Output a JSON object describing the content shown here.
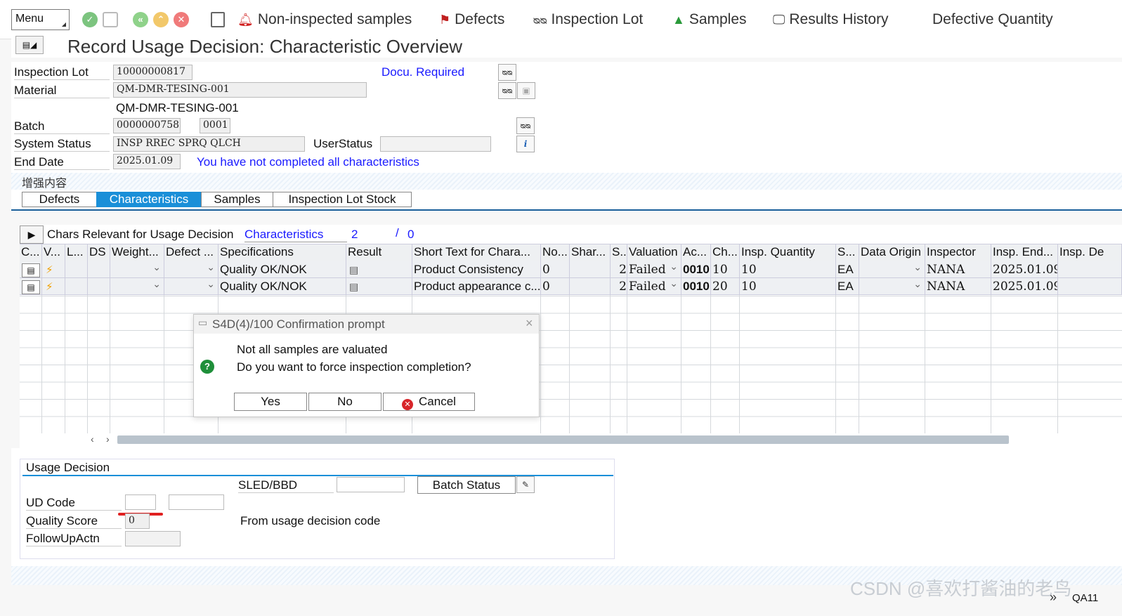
{
  "toolbar": {
    "menu_label": "Menu",
    "items": [
      {
        "label": "Non-inspected samples",
        "icon": "bell-icon"
      },
      {
        "label": "Defects",
        "icon": "flag-icon"
      },
      {
        "label": "Inspection Lot",
        "icon": "glasses-icon"
      },
      {
        "label": "Samples",
        "icon": "shapes-icon"
      },
      {
        "label": "Results History",
        "icon": "monitor-icon"
      },
      {
        "label": "Defective Quantity",
        "icon": ""
      }
    ]
  },
  "title": "Record Usage Decision: Characteristic Overview",
  "header": {
    "inspection_lot_label": "Inspection Lot",
    "inspection_lot": "10000000817",
    "docu_required": "Docu. Required",
    "material_label": "Material",
    "material": "QM-DMR-TESING-001",
    "material_desc": "QM-DMR-TESING-001",
    "batch_label": "Batch",
    "batch": "0000000758",
    "batch_sub": "0001",
    "system_status_label": "System Status",
    "system_status": "INSP RREC SPRQ QLCH",
    "user_status_label": "UserStatus",
    "end_date_label": "End Date",
    "end_date": "2025.01.09",
    "status_message": "You have not completed all characteristics",
    "enhanced_content": "增强内容"
  },
  "tabs": [
    "Defects",
    "Characteristics",
    "Samples",
    "Inspection Lot Stock"
  ],
  "grid": {
    "heading": "Chars Relevant for Usage Decision",
    "characteristics_label": "Characteristics",
    "count_done": "2",
    "slash": "/",
    "count_total": "0",
    "columns": [
      "C...",
      "V...",
      "L...",
      "DS",
      "Weight...",
      "Defect ...",
      "Specifications",
      "Result",
      "Short Text for Chara...",
      "No...",
      "Shar...",
      "S..",
      "Valuation",
      "Ac...",
      "Ch...",
      "Insp. Quantity",
      "S...",
      "Data Origin",
      "Inspector",
      "Insp. End...",
      "Insp. De"
    ],
    "rows": [
      {
        "spec": "Quality OK/NOK",
        "short_text": "Product Consistency",
        "no": "0",
        "s": "2",
        "valuation": "Failed",
        "ac": "0010",
        "ch": "10",
        "insp_qty": "10",
        "unit": "EA",
        "inspector": "NANA",
        "end_date": "2025.01.09"
      },
      {
        "spec": "Quality OK/NOK",
        "short_text": "Product appearance c...",
        "no": "0",
        "s": "2",
        "valuation": "Failed",
        "ac": "0010",
        "ch": "20",
        "insp_qty": "10",
        "unit": "EA",
        "inspector": "NANA",
        "end_date": "2025.01.09"
      }
    ]
  },
  "dialog": {
    "title": "S4D(4)/100 Confirmation prompt",
    "line1": "Not all samples are valuated",
    "line2": "Do you want to force inspection completion?",
    "yes": "Yes",
    "no": "No",
    "cancel": "Cancel"
  },
  "usage_decision": {
    "heading": "Usage Decision",
    "sled_label": "SLED/BBD",
    "batch_status_btn": "Batch Status",
    "ud_code_label": "UD Code",
    "quality_score_label": "Quality Score",
    "quality_score": "0",
    "from_ud_code": "From usage decision code",
    "followup_label": "FollowUpActn"
  },
  "footer": {
    "watermark": "CSDN @喜欢打酱油的老鸟",
    "tcode": "QA11"
  }
}
